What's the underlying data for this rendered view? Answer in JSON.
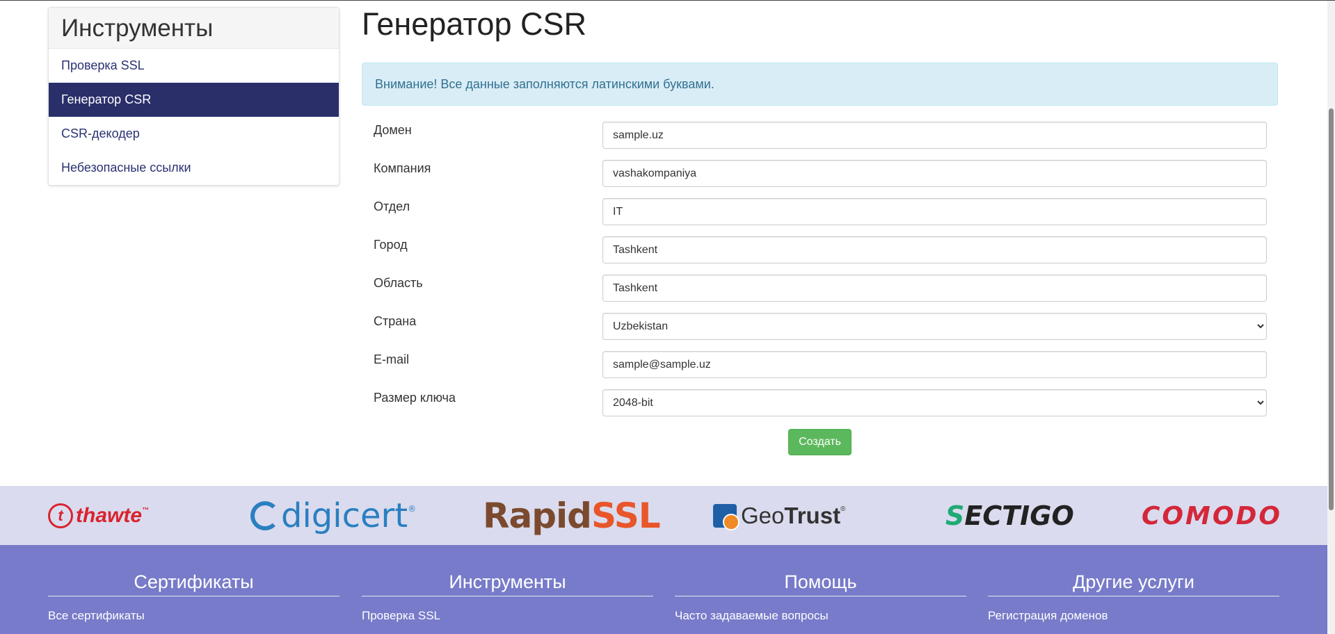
{
  "sidebar": {
    "title": "Инструменты",
    "items": [
      {
        "label": "Проверка SSL"
      },
      {
        "label": "Генератор CSR"
      },
      {
        "label": "CSR-декодер"
      },
      {
        "label": "Небезопасные ссылки"
      }
    ]
  },
  "main": {
    "title": "Генератор CSR",
    "alert": "Внимание! Все данные заполняются латинскими буквами.",
    "fields": {
      "domain": {
        "label": "Домен",
        "value": "sample.uz"
      },
      "company": {
        "label": "Компания",
        "value": "vashakompaniya"
      },
      "department": {
        "label": "Отдел",
        "value": "IT"
      },
      "city": {
        "label": "Город",
        "value": "Tashkent"
      },
      "region": {
        "label": "Область",
        "value": "Tashkent"
      },
      "country": {
        "label": "Страна",
        "value": "Uzbekistan"
      },
      "email": {
        "label": "E-mail",
        "value": "sample@sample.uz"
      },
      "keysize": {
        "label": "Размер ключа",
        "value": "2048-bit"
      }
    },
    "submit_label": "Создать"
  },
  "partners": {
    "thawte": {
      "mark": "t",
      "text": "thawte",
      "tm": "™"
    },
    "digicert": {
      "text": "digicert",
      "reg": "®"
    },
    "rapidssl": {
      "part1": "Rapid",
      "part2": "SSL"
    },
    "geotrust": {
      "part1": "Geo",
      "part2": "Trust",
      "reg": "®"
    },
    "sectigo": {
      "s": "S",
      "rest": "ECTIGO"
    },
    "comodo": {
      "text": "COMODO"
    }
  },
  "footer": {
    "columns": [
      {
        "heading": "Сертификаты",
        "link": "Все сертификаты"
      },
      {
        "heading": "Инструменты",
        "link": "Проверка SSL"
      },
      {
        "heading": "Помощь",
        "link": "Часто задаваемые вопросы"
      },
      {
        "heading": "Другие услуги",
        "link": "Регистрация доменов"
      }
    ]
  },
  "colors": {
    "sidebar_active": "#2a2f6a",
    "alert_bg": "#d9edf7",
    "button_green": "#5cb85c",
    "partners_bg": "#dadbee",
    "footer_bg": "#777bc9"
  }
}
